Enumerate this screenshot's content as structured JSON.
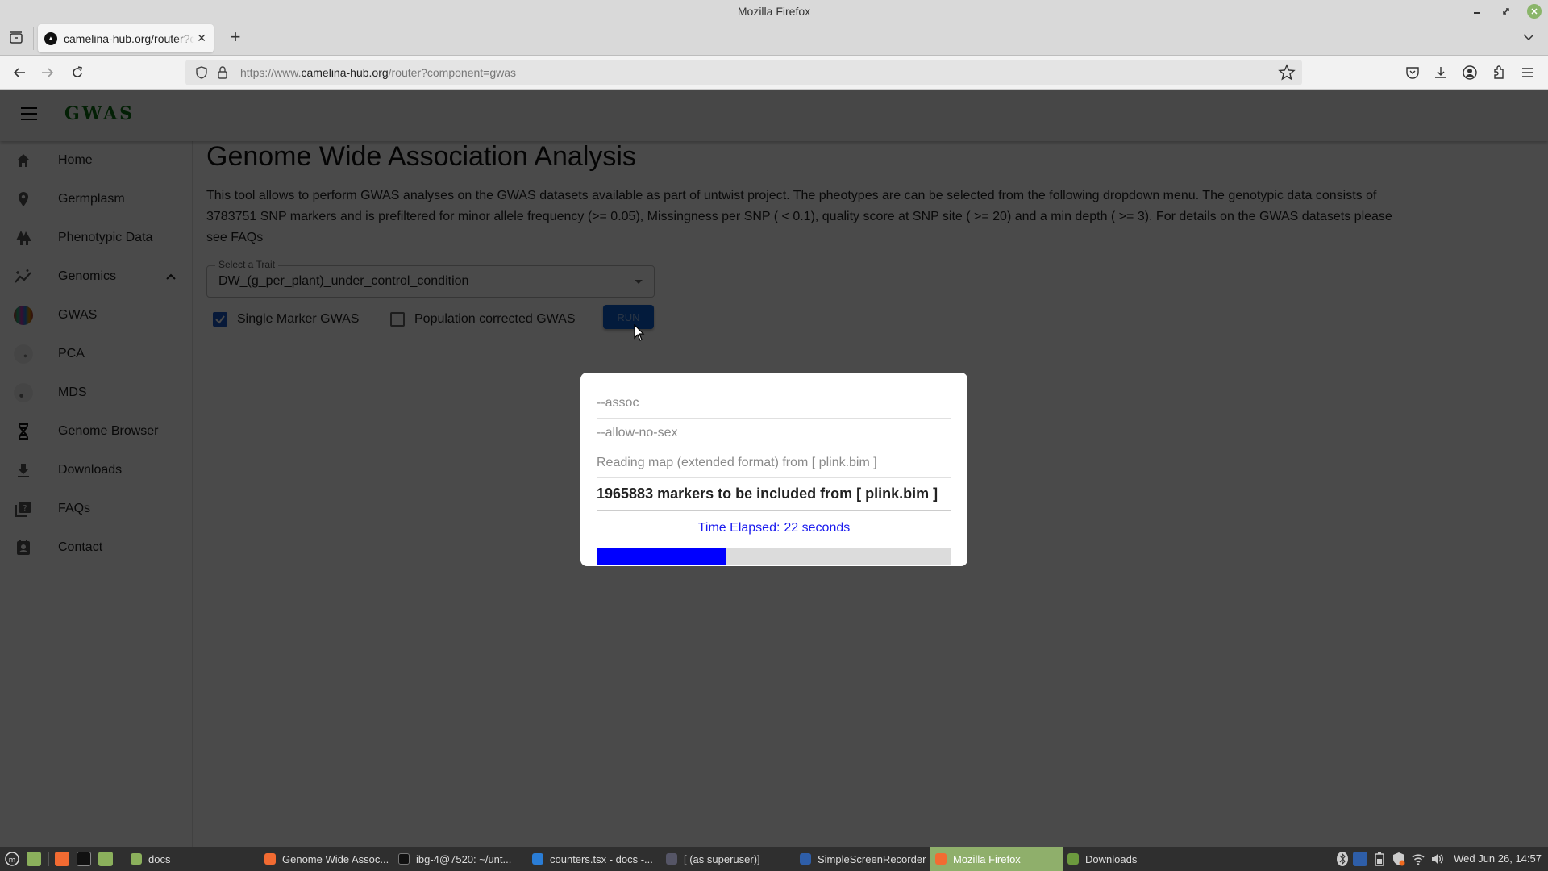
{
  "window": {
    "title": "Mozilla Firefox"
  },
  "browser": {
    "tab": {
      "title": "camelina-hub.org/router?component=gwas",
      "favicon": "camelina-favicon"
    },
    "url": {
      "prefix": "https://www.",
      "host": "camelina-hub.org",
      "path": "/router?component=gwas"
    }
  },
  "app": {
    "logo": "GWAS",
    "sidebar": {
      "items": [
        {
          "label": "Home",
          "icon": "home-icon"
        },
        {
          "label": "Germplasm",
          "icon": "location-pin-icon"
        },
        {
          "label": "Phenotypic Data",
          "icon": "trees-icon"
        },
        {
          "label": "Genomics",
          "icon": "insights-icon",
          "expanded": true
        },
        {
          "label": "GWAS",
          "icon": "gwas-thumbnail"
        },
        {
          "label": "PCA",
          "icon": "pca-thumbnail"
        },
        {
          "label": "MDS",
          "icon": "mds-thumbnail"
        },
        {
          "label": "Genome Browser",
          "icon": "dna-icon"
        },
        {
          "label": "Downloads",
          "icon": "download-icon"
        },
        {
          "label": "FAQs",
          "icon": "help-library-icon"
        },
        {
          "label": "Contact",
          "icon": "contact-card-icon"
        }
      ]
    },
    "main": {
      "title": "Genome Wide Association Analysis",
      "description": "This tool allows to perform GWAS analyses on the GWAS datasets available as part of untwist project. The pheotypes are can be selected from the following dropdown menu. The genotypic data consists of 3783751 SNP markers and is prefiltered for minor allele frequency (>= 0.05), Missingness per SNP ( < 0.1), quality score at SNP site ( >= 20) and a min depth ( >= 3). For details on the GWAS datasets please see FAQs",
      "trait_select": {
        "label": "Select a Trait",
        "value": "DW_(g_per_plant)_under_control_condition"
      },
      "options": [
        {
          "label": "Single Marker GWAS",
          "checked": true
        },
        {
          "label": "Population corrected GWAS",
          "checked": false
        }
      ],
      "run_label": "RUN"
    },
    "dialog": {
      "log_lines": [
        "--assoc",
        "--allow-no-sex",
        "Reading map (extended format) from [ plink.bim ]"
      ],
      "highlight_line": "1965883 markers to be included from [ plink.bim ]",
      "elapsed_label": "Time Elapsed:",
      "elapsed_value": "22 seconds",
      "progress_percent": 36.5,
      "progress_color": "#0000ff"
    }
  },
  "taskbar": {
    "launchers": [
      "menu-icon",
      "show-desktop-icon",
      "firefox-icon",
      "terminal-icon",
      "files-icon"
    ],
    "items": [
      {
        "label": "docs",
        "icon": "folder-icon",
        "active": false
      },
      {
        "label": "Genome Wide Assoc...",
        "icon": "firefox-icon",
        "active": false
      },
      {
        "label": "ibg-4@7520: ~/unt...",
        "icon": "terminal-icon",
        "active": false
      },
      {
        "label": "counters.tsx - docs -...",
        "icon": "vscode-icon",
        "active": false
      },
      {
        "label": "[ (as superuser)]",
        "icon": "package-icon",
        "active": false
      },
      {
        "label": "SimpleScreenRecorder",
        "icon": "screenrecorder-icon",
        "active": false
      },
      {
        "label": "Mozilla Firefox",
        "icon": "firefox-icon",
        "active": true
      },
      {
        "label": "Downloads",
        "icon": "downloads-folder-icon",
        "active": false
      }
    ],
    "clock": "Wed Jun 26, 14:57"
  }
}
